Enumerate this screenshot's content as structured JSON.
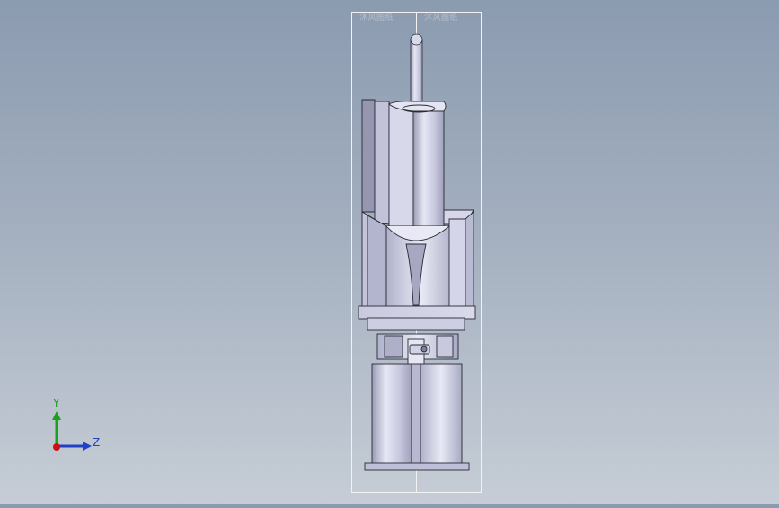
{
  "viewport": {
    "background_top": "#8b9bb0",
    "background_bottom": "#c6cdd6",
    "model_color_light": "#e2e3f1",
    "model_color_mid": "#c4c5db",
    "model_color_dark": "#8d8fa8",
    "edge_color": "#2a2a36",
    "bbox_color": "#f0f0f0"
  },
  "triad": {
    "y_label": "Y",
    "z_label": "Z",
    "y_color": "#1ea01e",
    "z_color": "#2040c8",
    "origin_color": "#d01010"
  },
  "watermark": {
    "left_text": "沐风图纸",
    "right_text": "沐风图纸"
  }
}
